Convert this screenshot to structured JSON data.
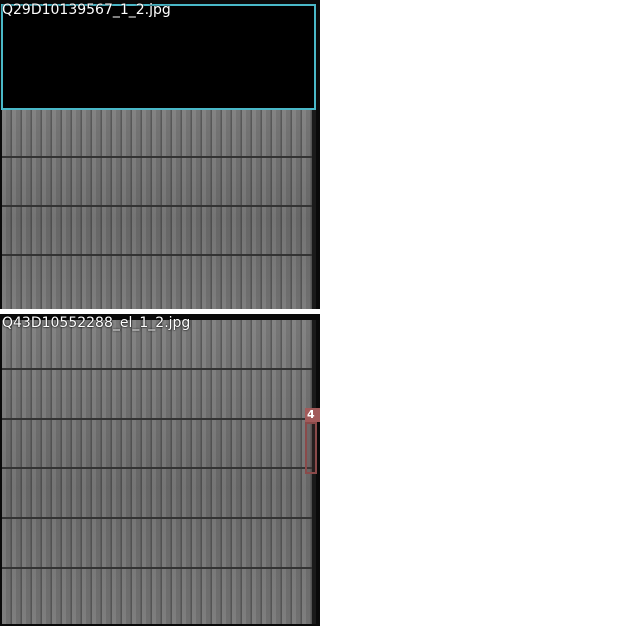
{
  "panels": [
    {
      "filename": "Q29D10139567_1_2.jpg"
    },
    {
      "filename": "Q43D10552288_el_1_2.jpg",
      "defect_label": "4"
    }
  ],
  "colors": {
    "highlight_box": "#4ab8c8",
    "defect_box": "#8a4a4a",
    "defect_tag": "#a25a5a"
  }
}
